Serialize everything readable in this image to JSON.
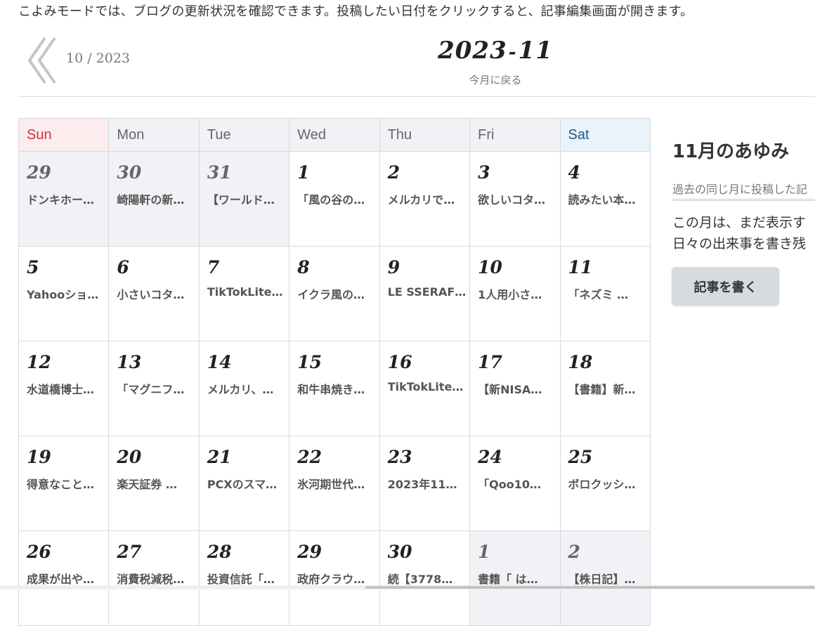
{
  "intro": "こよみモードでは、ブログの更新状況を確認できます。投稿したい日付をクリックすると、記事編集画面が開きます。",
  "nav": {
    "prev_label": "10 / 2023",
    "current_year": "2023",
    "current_sep": "-",
    "current_month": "11",
    "back_today": "今月に戻る"
  },
  "calendar": {
    "weekdays": [
      "Sun",
      "Mon",
      "Tue",
      "Wed",
      "Thu",
      "Fri",
      "Sat"
    ],
    "weeks": [
      [
        {
          "day": "29",
          "post": "ドンキホー…"
        },
        {
          "day": "30",
          "post": "崎陽軒の新…"
        },
        {
          "day": "31",
          "post": "【ワールド…"
        },
        {
          "day": "1",
          "post": "「風の谷の…"
        },
        {
          "day": "2",
          "post": "メルカリで…"
        },
        {
          "day": "3",
          "post": "欲しいコタ…"
        },
        {
          "day": "4",
          "post": "読みたい本…"
        }
      ],
      [
        {
          "day": "5",
          "post": "Yahooショ…"
        },
        {
          "day": "6",
          "post": "小さいコタ…"
        },
        {
          "day": "7",
          "post": "TikTokLite…"
        },
        {
          "day": "8",
          "post": "イクラ風の…"
        },
        {
          "day": "9",
          "post": "LE SSERAF…"
        },
        {
          "day": "10",
          "post": "1人用小さ…"
        },
        {
          "day": "11",
          "post": "「ネズミ …"
        }
      ],
      [
        {
          "day": "12",
          "post": "水道橋博士…"
        },
        {
          "day": "13",
          "post": "「マグニフ…"
        },
        {
          "day": "14",
          "post": "メルカリ、…"
        },
        {
          "day": "15",
          "post": "和牛串焼き…"
        },
        {
          "day": "16",
          "post": "TikTokLite…"
        },
        {
          "day": "17",
          "post": "【新NISA…"
        },
        {
          "day": "18",
          "post": "【書籍】新…"
        }
      ],
      [
        {
          "day": "19",
          "post": "得意なこと…"
        },
        {
          "day": "20",
          "post": "楽天証券 …"
        },
        {
          "day": "21",
          "post": "PCXのスマ…"
        },
        {
          "day": "22",
          "post": "氷河期世代…"
        },
        {
          "day": "23",
          "post": "2023年11…"
        },
        {
          "day": "24",
          "post": "「Qoo10…"
        },
        {
          "day": "25",
          "post": "ボロクッシ…"
        }
      ],
      [
        {
          "day": "26",
          "post": "成果が出や…"
        },
        {
          "day": "27",
          "post": "消費税減税…"
        },
        {
          "day": "28",
          "post": "投資信託「…"
        },
        {
          "day": "29",
          "post": "政府クラウ…"
        },
        {
          "day": "30",
          "post": "続【3778…"
        },
        {
          "day": "1",
          "post": "書籍「 は…"
        },
        {
          "day": "2",
          "post": "【株日記】…"
        }
      ]
    ]
  },
  "sidebar": {
    "title": "11月のあゆみ",
    "past_link": "過去の同じ月に投稿した記",
    "text_line1": "この月は、まだ表示す",
    "text_line2": "日々の出来事を書き残",
    "write_button": "記事を書く"
  }
}
